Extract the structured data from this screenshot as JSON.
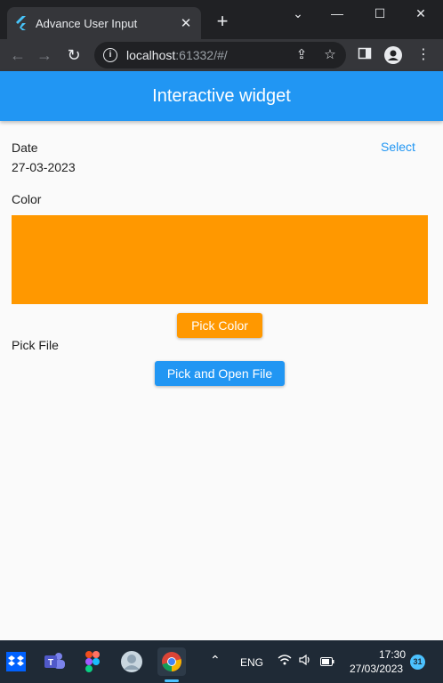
{
  "browser": {
    "tab_title": "Advance User Input",
    "new_tab_glyph": "+",
    "url_host": "localhost",
    "url_rest": ":61332/#/"
  },
  "app": {
    "title": "Interactive widget",
    "date_label": "Date",
    "date_value": "27-03-2023",
    "select_label": "Select",
    "color_label": "Color",
    "selected_color": "#ff9800",
    "pick_color_label": "Pick Color",
    "pick_file_label": "Pick File",
    "pick_open_file_label": "Pick and Open File"
  },
  "colors": {
    "accent_blue": "#2196f3",
    "accent_orange": "#ff9800"
  },
  "taskbar": {
    "language": "ENG",
    "time": "17:30",
    "date": "27/03/2023",
    "notification_count": "31",
    "apps": [
      "dropbox-icon",
      "teams-icon",
      "figma-icon",
      "avatar-app-icon",
      "chrome-icon"
    ]
  }
}
